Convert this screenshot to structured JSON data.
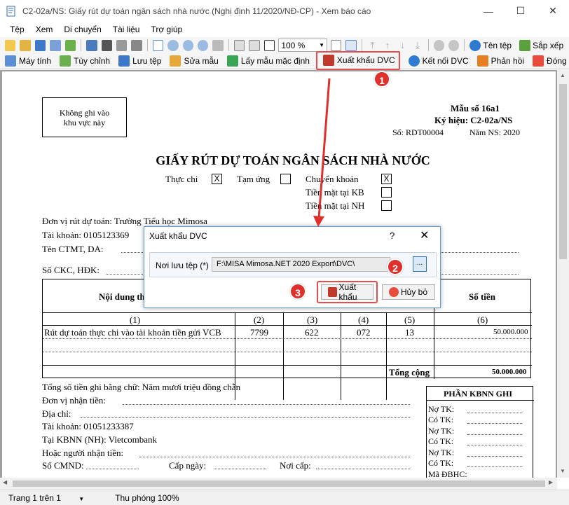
{
  "window": {
    "title": "C2-02a/NS: Giấy rút dự toán ngân sách nhà nước (Nghị định 11/2020/NĐ-CP) - Xem báo cáo",
    "minimize": "—",
    "maximize": "☐",
    "close": "✕"
  },
  "menu": [
    "Tệp",
    "Xem",
    "Di chuyển",
    "Tài liệu",
    "Trợ giúp"
  ],
  "toolbar1": {
    "zoom": "100 %",
    "rename_label": "Tên tệp",
    "sort_label": "Sắp xếp"
  },
  "toolbar2": {
    "calculator": "Máy tính",
    "customize": "Tùy chỉnh",
    "save_file": "Lưu tệp",
    "edit_template": "Sửa mẫu",
    "default_template": "Lấy mẫu mặc định",
    "export_dvc": "Xuất khẩu DVC",
    "connect_dvc": "Kết nối DVC",
    "feedback": "Phản hồi",
    "close": "Đóng"
  },
  "document": {
    "no_write_box": [
      "Không ghi vào",
      "khu vực này"
    ],
    "form_no": "Mẫu số 16a1",
    "symbol": "Ký hiệu: C2-02a/NS",
    "number": "Số: RDT00004",
    "fiscal_year": "Năm NS: 2020",
    "title": "GIẤY RÚT DỰ TOÁN NGÂN SÁCH NHÀ NƯỚC",
    "actual_label": "Thực chi",
    "actual_check": "X",
    "advance_label": "Tạm ứng",
    "transfer_label": "Chuyển khoản",
    "transfer_check": "X",
    "cash_kb_label": "Tiền mặt tại KB",
    "cash_nh_label": "Tiền mặt tại NH",
    "unit_line": "Đơn vị rút dự toán: Trường Tiểu học Mimosa",
    "account_line": "Tài khoản: 0105123369",
    "ctmt_label": "Tên  CTMT, DA:",
    "ckc_label": "Số CKC, HĐK:",
    "col_content": "Nội dung th",
    "col_amount": "Số tiền",
    "col_nums": [
      "(1)",
      "(2)",
      "(3)",
      "(4)",
      "(5)",
      "(6)"
    ],
    "row1": [
      "Rút dự toán thực chi vào tài khoản tiền gửi VCB",
      "7799",
      "622",
      "072",
      "13",
      "50.000.000"
    ],
    "total_label": "Tổng cộng",
    "total_value": "50.000.000",
    "words_line": "Tổng số tiền ghi bằng chữ: Năm mươi triệu đồng chẵn",
    "payee_label": "Đơn vị nhận tiền:",
    "address_label": "Địa  chỉ:",
    "payee_account": "Tài khoản: 01051233387",
    "payee_bank": "Tại KBNN (NH): Vietcombank",
    "or_person": "Hoặc người nhận tiền:",
    "id_label": "Số CMND:",
    "issue_date": "Cấp ngày:",
    "issue_place": "Nơi cấp:",
    "kbnn_title": "PHẦN KBNN GHI",
    "kbnn_rows": [
      "Nợ TK:",
      "Có TK:",
      "Nợ TK:",
      "Có TK:",
      "Nợ TK:",
      "Có TK:",
      "Mã ĐBHC:"
    ]
  },
  "dialog": {
    "title": "Xuất khẩu DVC",
    "help": "?",
    "close": "✕",
    "folder_label": "Nơi lưu tệp (*)",
    "folder_value": "F:\\MISA Mimosa.NET 2020 Export\\DVC\\",
    "browse": "...",
    "export_button": "Xuất khẩu",
    "cancel_button": "Hủy bỏ"
  },
  "annotations": [
    "1",
    "2",
    "3"
  ],
  "status": {
    "page": "Trang 1 trên 1",
    "zoom": "Thu phóng 100%"
  },
  "colors": {
    "annotation_red": "#e0302c",
    "dialog_border": "#5a9bd5"
  }
}
